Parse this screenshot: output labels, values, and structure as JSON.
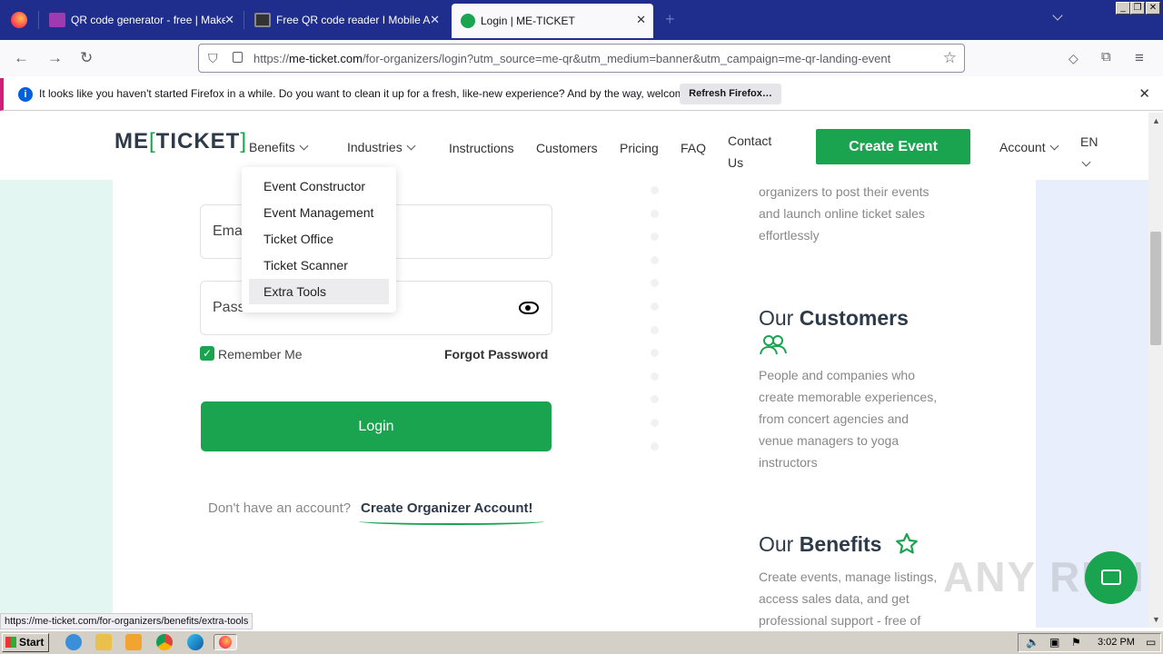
{
  "browser": {
    "tabs": [
      {
        "title": "QR code generator - free | Make C"
      },
      {
        "title": "Free QR code reader I Mobile App"
      },
      {
        "title": "Login | ME-TICKET"
      }
    ],
    "url_prefix": "https://",
    "url_domain": "me-ticket.com",
    "url_path": "/for-organizers/login?utm_source=me-qr&utm_medium=banner&utm_campaign=me-qr-landing-event",
    "notification": {
      "message": "It looks like you haven't started Firefox in a while. Do you want to clean it up for a fresh, like-new experience? And by the way, welcome back!",
      "button": "Refresh Firefox…"
    },
    "status_link": "https://me-ticket.com/for-organizers/benefits/extra-tools"
  },
  "header": {
    "logo_left": "ME",
    "logo_right": "TICKET",
    "nav": {
      "benefits": "Benefits",
      "industries": "Industries",
      "instructions": "Instructions",
      "customers": "Customers",
      "pricing": "Pricing",
      "faq": "FAQ",
      "contact_1": "Contact",
      "contact_2": "Us",
      "account": "Account",
      "lang": "EN"
    },
    "create_event": "Create Event"
  },
  "dropdown": {
    "items": [
      "Event Constructor",
      "Event Management",
      "Ticket Office",
      "Ticket Scanner",
      "Extra Tools"
    ]
  },
  "form": {
    "email_label": "Email",
    "password_label": "Password",
    "remember": "Remember Me",
    "forgot": "Forgot Password",
    "login": "Login",
    "no_account": "Don't have an account?",
    "create_account": "Create Organizer Account!"
  },
  "right": {
    "intro_1": "organizers to post their events",
    "intro_2": "and launch online ticket sales",
    "intro_3": "effortlessly",
    "customers_head_1": "Our",
    "customers_head_2": "Customers",
    "customers_1": "People and companies who",
    "customers_2": "create memorable experiences,",
    "customers_3": "from concert agencies and",
    "customers_4": "venue managers to yoga",
    "customers_5": "instructors",
    "benefits_head_1": "Our",
    "benefits_head_2": "Benefits",
    "benefits_1": "Create events, manage listings,",
    "benefits_2": "access sales data, and get",
    "benefits_3": "professional support - free of"
  },
  "taskbar": {
    "start": "Start",
    "clock": "3:02 PM"
  },
  "watermark": "ANY RUN",
  "colors": {
    "brand_green": "#1aa450",
    "tabstrip": "#1f2d8c"
  }
}
